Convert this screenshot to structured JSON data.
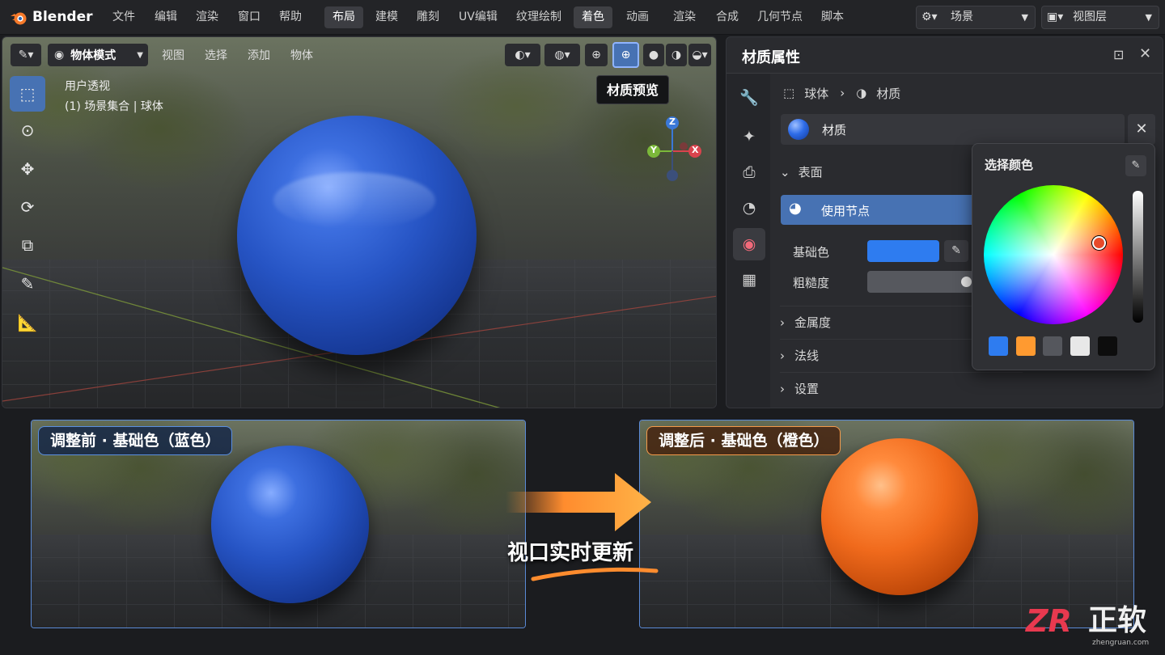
{
  "app": {
    "name": "Blender"
  },
  "menu": [
    "文件",
    "编辑",
    "渲染",
    "窗口",
    "帮助"
  ],
  "workspaces": [
    "布局",
    "建模",
    "雕刻",
    "UV编辑",
    "纹理绘制",
    "着色",
    "动画",
    "渲染",
    "合成",
    "几何节点",
    "脚本"
  ],
  "active_workspace": "着色",
  "scene_selector": {
    "value": "场景"
  },
  "view_layer_selector": {
    "value": "视图层"
  },
  "viewport": {
    "mode": "物体模式",
    "menus": [
      "视图",
      "选择",
      "添加",
      "物体"
    ],
    "overlay_line1": "用户透视",
    "overlay_line2": "(1) 场景集合 | 球体",
    "tooltip": "材质预览",
    "gizmo": {
      "z": "Z",
      "y": "Y",
      "x": "X"
    }
  },
  "properties": {
    "title": "材质属性",
    "breadcrumb": {
      "object": "球体",
      "material": "材质"
    },
    "material_slot": "材质",
    "surface_label": "表面",
    "use_nodes_label": "使用节点",
    "base_color_label": "基础色",
    "roughness_label": "粗糙度",
    "roughness_value": 0.5,
    "sections": [
      "金属度",
      "法线",
      "设置"
    ]
  },
  "color_picker": {
    "title": "选择颜色",
    "swatches": [
      "#2e7cf0",
      "#ff9a30",
      "#55575d",
      "#e8e8e8",
      "#0d0d0d"
    ]
  },
  "colors": {
    "accent": "#4772b3",
    "blue_sphere": "#2f5fcf",
    "orange_sphere": "#f06a1c",
    "base_color": "#2e7cf0"
  },
  "compare": {
    "before_label": "调整前 · 基础色（蓝色）",
    "after_label": "调整后 · 基础色（橙色）",
    "arrow_caption": "视口实时更新"
  },
  "watermark": {
    "brand": "正软",
    "url": "zhengruan.com"
  }
}
